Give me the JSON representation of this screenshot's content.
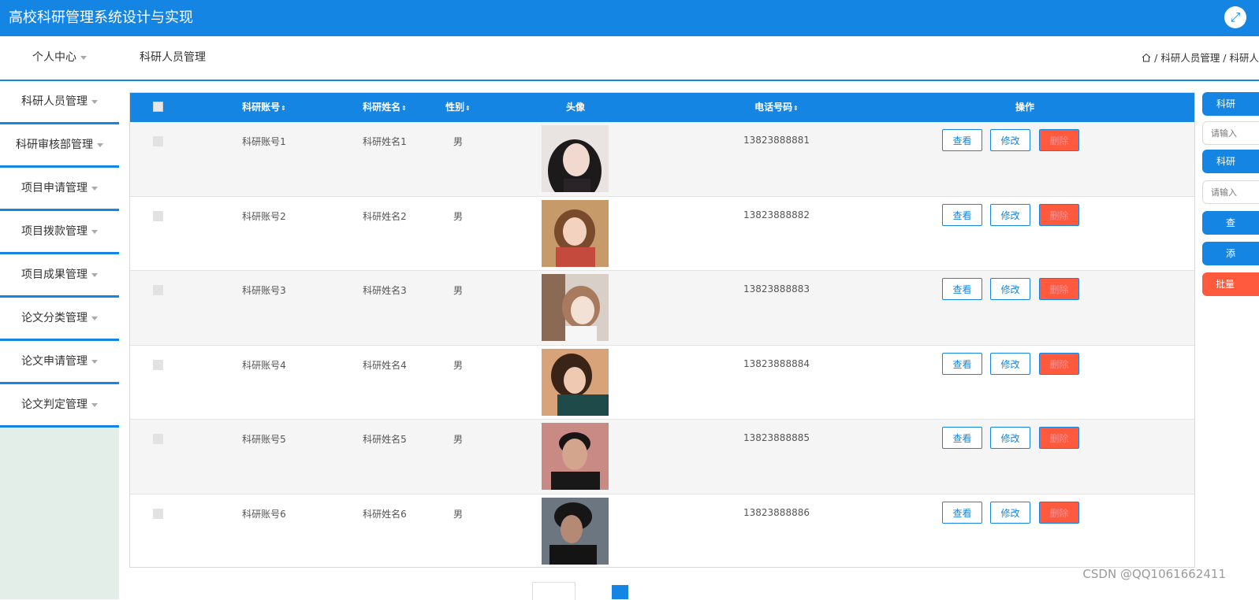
{
  "header": {
    "title": "高校科研管理系统设计与实现"
  },
  "subbar": {
    "personal_center": "个人中心",
    "page_title": "科研人员管理",
    "breadcrumb": " / 科研人员管理 / 科研人"
  },
  "sidebar": {
    "items": [
      {
        "label": "科研人员管理"
      },
      {
        "label": "科研审核部管理"
      },
      {
        "label": "项目申请管理"
      },
      {
        "label": "项目拨款管理"
      },
      {
        "label": "项目成果管理"
      },
      {
        "label": "论文分类管理"
      },
      {
        "label": "论文申请管理"
      },
      {
        "label": "论文判定管理"
      }
    ]
  },
  "table": {
    "headers": {
      "account": "科研账号",
      "name": "科研姓名",
      "gender": "性别",
      "avatar": "头像",
      "phone": "电话号码",
      "actions": "操作"
    },
    "sort_glyph": "⇕",
    "view_label": "查看",
    "edit_label": "修改",
    "delete_label": "删除",
    "rows": [
      {
        "account": "科研账号1",
        "name": "科研姓名1",
        "gender": "男",
        "phone": "13823888881"
      },
      {
        "account": "科研账号2",
        "name": "科研姓名2",
        "gender": "男",
        "phone": "13823888882"
      },
      {
        "account": "科研账号3",
        "name": "科研姓名3",
        "gender": "男",
        "phone": "13823888883"
      },
      {
        "account": "科研账号4",
        "name": "科研姓名4",
        "gender": "男",
        "phone": "13823888884"
      },
      {
        "account": "科研账号5",
        "name": "科研姓名5",
        "gender": "男",
        "phone": "13823888885"
      },
      {
        "account": "科研账号6",
        "name": "科研姓名6",
        "gender": "男",
        "phone": "13823888886"
      }
    ]
  },
  "right_panel": {
    "label1": "科研",
    "input1_placeholder": "请输入",
    "label2": "科研",
    "input2_placeholder": "请输入",
    "search_label": "查",
    "add_label": "添",
    "batch_label": "批量"
  },
  "watermark": "CSDN @QQ1061662411"
}
